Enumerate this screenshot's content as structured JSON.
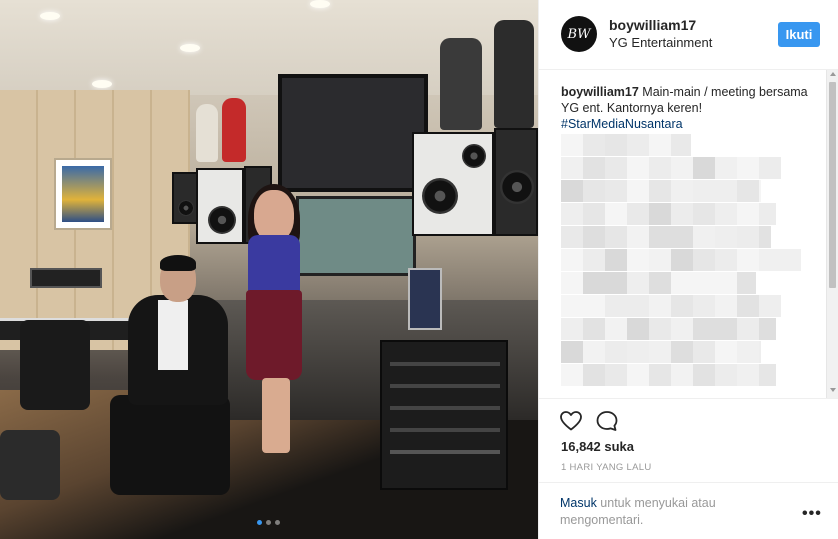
{
  "post": {
    "username": "boywilliam17",
    "avatar_text": "BW",
    "location": "YG Entertainment",
    "follow_label": "Ikuti",
    "caption_user": "boywilliam17",
    "caption_text": " Main-main / meeting bersama YG ent. Kantornya keren!",
    "hashtag": "#StarMediaNusantara",
    "likes": "16,842 suka",
    "time_ago": "1 HARI YANG LALU",
    "login_link": "Masuk",
    "login_rest": " untuk menyukai atau mengomentari.",
    "more_label": "•••"
  },
  "carousel": {
    "total": 3,
    "active_index": 0
  },
  "icons": {
    "like": "heart-outline-icon",
    "comment": "comment-bubble-icon",
    "more": "more-options-icon"
  },
  "colors": {
    "accent": "#3897f0",
    "link": "#003569",
    "muted": "#999999",
    "text": "#262626"
  }
}
